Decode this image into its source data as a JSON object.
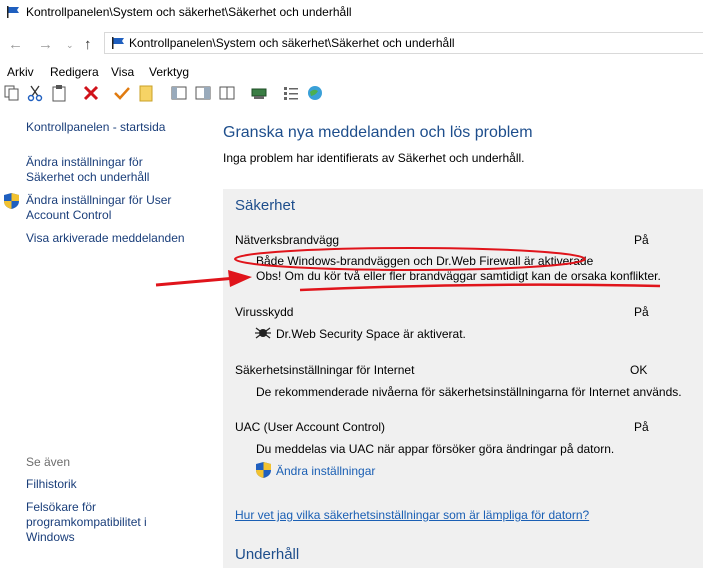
{
  "window": {
    "title": "Kontrollpanelen\\System och säkerhet\\Säkerhet och underhåll"
  },
  "address": {
    "path": "Kontrollpanelen\\System och säkerhet\\Säkerhet och underhåll"
  },
  "menu": [
    "Arkiv",
    "Redigera",
    "Visa",
    "Verktyg"
  ],
  "toolbar_icons": [
    "copy-icon",
    "cut-icon",
    "paste-icon",
    "delete-icon",
    "check-icon",
    "note-icon",
    "layout-icon",
    "layout-split-icon",
    "layout-columns-icon",
    "network-icon",
    "list-icon",
    "globe-icon"
  ],
  "sidebar": {
    "home": "Kontrollpanelen - startsida",
    "change_settings": "Ändra inställningar för Säkerhet och underhåll",
    "uac_settings": "Ändra inställningar för User Account Control",
    "archived": "Visa arkiverade meddelanden",
    "see_also": "Se även",
    "file_history": "Filhistorik",
    "troubleshooter": "Felsökare för programkompatibilitet i Windows"
  },
  "main": {
    "heading": "Granska nya meddelanden och lös problem",
    "subheading": "Inga problem har identifierats av Säkerhet och underhåll.",
    "security_title": "Säkerhet",
    "maintenance_title": "Underhåll",
    "items": {
      "firewall": {
        "label": "Nätverksbrandvägg",
        "status": "På",
        "desc1": "Både Windows-brandväggen och Dr.Web Firewall är aktiverade",
        "desc2": "Obs! Om du kör två eller fler brandväggar samtidigt kan de orsaka konflikter."
      },
      "virus": {
        "label": "Virusskydd",
        "status": "På",
        "desc": "Dr.Web Security Space är aktiverat."
      },
      "internet": {
        "label": "Säkerhetsinställningar för Internet",
        "status": "OK",
        "desc": "De rekommenderade nivåerna för säkerhetsinställningarna för Internet används."
      },
      "uac": {
        "label": "UAC (User Account Control)",
        "status": "På",
        "desc": "Du meddelas via UAC när appar försöker göra ändringar på datorn.",
        "link": "Ändra inställningar"
      }
    },
    "help_link": "Hur vet jag vilka säkerhetsinställningar som är lämpliga för datorn?"
  },
  "colors": {
    "accent": "#1e4e8c",
    "link": "#1a5fb4",
    "annotation": "#e0141b",
    "panel": "#f0f0f0"
  }
}
